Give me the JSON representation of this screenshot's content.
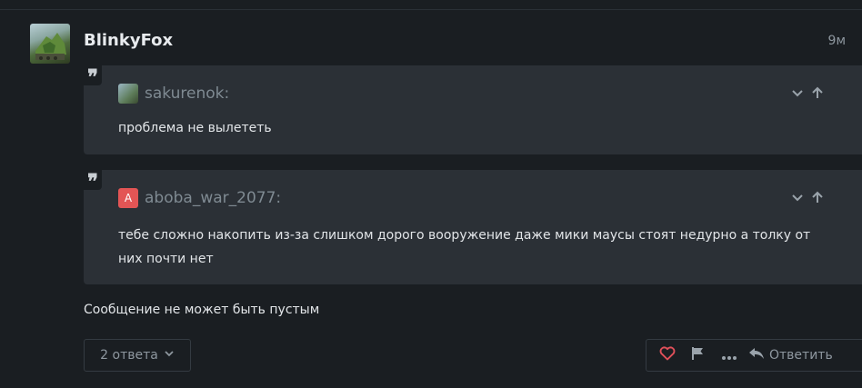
{
  "post": {
    "author": "BlinkyFox",
    "time": "9м",
    "message": "Сообщение не может быть пустым"
  },
  "quotes": [
    {
      "user": "sakurenok:",
      "text": "проблема не вылететь"
    },
    {
      "user": "aboba_war_2077:",
      "avatar_letter": "A",
      "avatar_color": "#e35555",
      "text": "тебе сложно накопить из-за слишком дорого вооружение даже мики маусы стоят недурно а толку от них почти нет"
    }
  ],
  "footer": {
    "replies_label": "2 ответа",
    "reply_label": "Ответить"
  },
  "colors": {
    "background": "#1a1e22",
    "quote_bg": "#2b3036",
    "like_icon": "#e0505a"
  }
}
